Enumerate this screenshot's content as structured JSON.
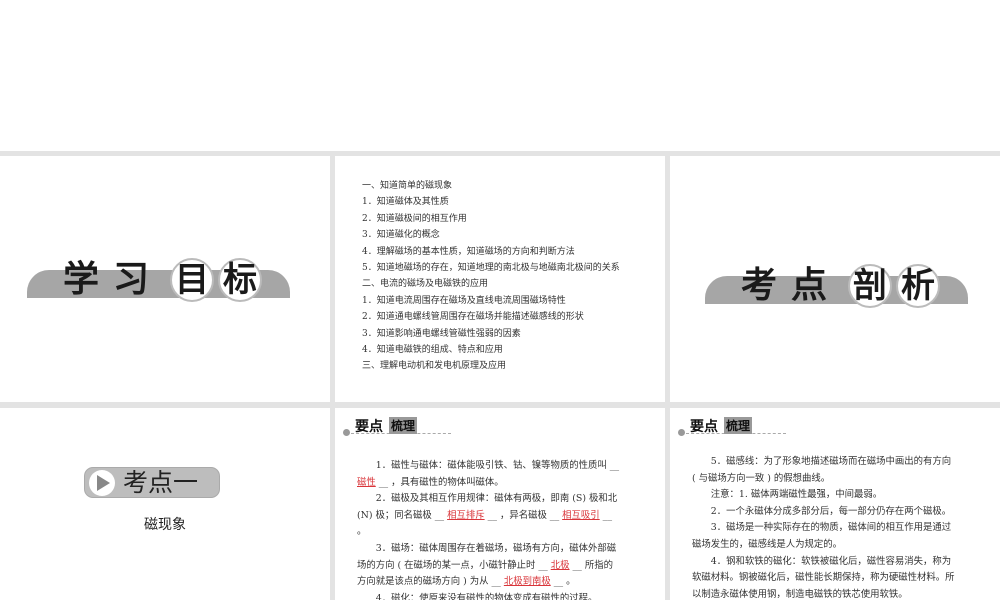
{
  "slide1": {
    "title_chars": [
      "学",
      "习",
      "目",
      "标"
    ]
  },
  "slide2": {
    "goals": [
      "一、知道简单的磁现象",
      "1．知道磁体及其性质",
      "2．知道磁极间的相互作用",
      "3．知道磁化的概念",
      "4．理解磁场的基本性质，知道磁场的方向和判断方法",
      "5．知道地磁场的存在，知道地理的南北极与地磁南北极间的关系",
      "二、电流的磁场及电磁铁的应用",
      "1．知道电流周围存在磁场及直线电流周围磁场特性",
      "2．知道通电螺线管周围存在磁场并能描述磁感线的形状",
      "3．知道影响通电螺线管磁性强弱的因素",
      "4．知道电磁铁的组成、特点和应用",
      "三、理解电动机和发电机原理及应用"
    ]
  },
  "slide3": {
    "title_chars": [
      "考",
      "点",
      "剖",
      "析"
    ]
  },
  "slide4": {
    "badge": "考点一",
    "subtitle": "磁现象"
  },
  "header": {
    "a": "要点",
    "b": "梳理"
  },
  "slide5": {
    "p1a": "1．磁性与磁体：磁体能吸引铁、钴、镍等物质的性质叫 __ ",
    "p1ans": "磁性",
    "p1b": " __ ，具有磁性的物体叫磁体。",
    "p2a": "2．磁极及其相互作用规律：磁体有两极，即南 (S) 极和北 (N) 极；同名磁极 __ ",
    "p2ans1": "相互排斥",
    "p2b": " __ ，异名磁极 __ ",
    "p2ans2": "相互吸引",
    "p2c": " __ 。",
    "p3a": "3．磁场：磁体周围存在着磁场，磁场有方向，磁体外部磁场的方向 ( 在磁场的某一点，小磁针静止时 __ ",
    "p3ans1": "北极",
    "p3b": " __ 所指的方向就是该点的磁场方向 ) 为从 __ ",
    "p3ans2": "北极到南极",
    "p3c": " __ 。",
    "p4": "4．磁化：使原来没有磁性的物体变成有磁性的过程。"
  },
  "slide6": {
    "paras": [
      "5．磁感线：为了形象地描述磁场而在磁场中画出的有方向 ( 与磁场方向一致 ) 的假想曲线。",
      "注意：1. 磁体两端磁性最强，中间最弱。",
      "2．一个永磁体分成多部分后，每一部分仍存在两个磁极。",
      "3．磁场是一种实际存在的物质，磁体间的相互作用是通过磁场发生的，磁感线是人为规定的。",
      "4．钢和软铁的磁化：软铁被磁化后，磁性容易消失，称为软磁材料。钢被磁化后，磁性能长期保持，称为硬磁性材料。所以制造永磁体使用钢，制造电磁铁的铁芯使用软铁。"
    ]
  }
}
